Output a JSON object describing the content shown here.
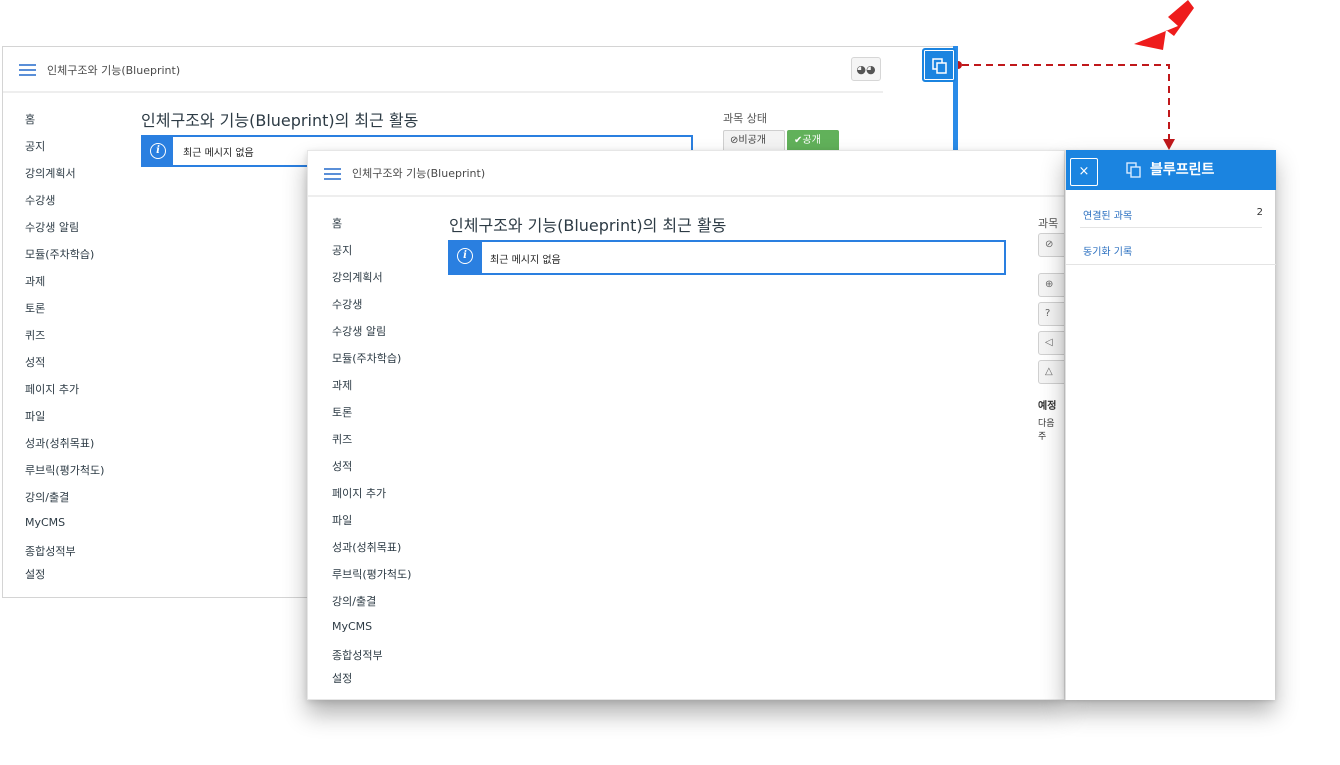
{
  "breadcrumb": "인체구조와 기능(Blueprint)",
  "page_title": "인체구조와 기능(Blueprint)의 최근 활동",
  "notice": "최근 메시지 없음",
  "nav_items": [
    "홈",
    "공지",
    "강의계획서",
    "수강생",
    "수강생 알림",
    "모듈(주차학습)",
    "과제",
    "토론",
    "퀴즈",
    "성적",
    "페이지 추가",
    "파일",
    "성과(성취목표)",
    "루브릭(평가척도)",
    "강의/출결",
    "MyCMS",
    "종합성적부",
    "설정"
  ],
  "course_status": {
    "label": "과목 상태",
    "label_cut": "과목",
    "unpublish": "비공개",
    "publish": "공개"
  },
  "upcoming": {
    "label": "예정",
    "sub": "다음 주"
  },
  "blueprint_panel": {
    "title": "블루프린트",
    "close": "×",
    "rows": [
      {
        "label": "연결된 과목",
        "count": "2"
      },
      {
        "label": "동기화 기록",
        "count": ""
      }
    ]
  },
  "colors": {
    "accent": "#1b84e0",
    "publish": "#61b15a",
    "arrow": "#cc1a1a"
  },
  "icons": [
    "hamburger-icon",
    "glasses-icon",
    "info-icon",
    "blueprint-copy-icon",
    "close-icon",
    "ban-icon",
    "check-icon",
    "arrow-icon"
  ]
}
